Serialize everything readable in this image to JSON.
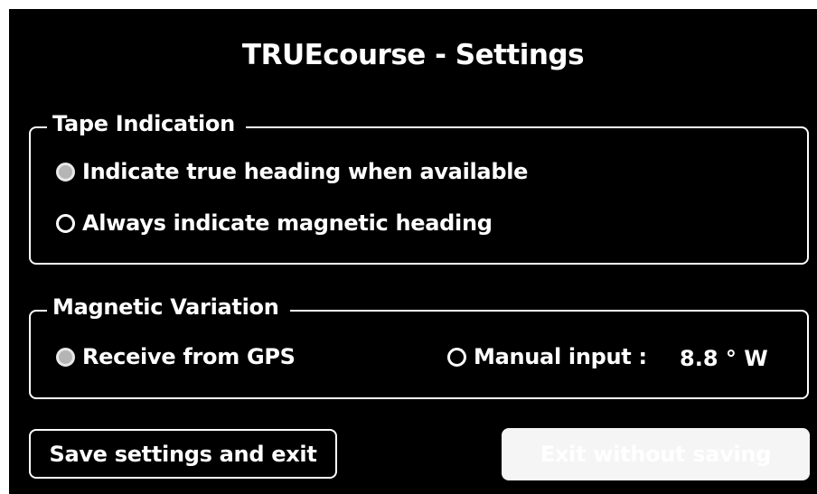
{
  "title": "TRUEcourse - Settings",
  "tape": {
    "legend": "Tape Indication",
    "options": [
      {
        "label": "Indicate true heading when available",
        "selected": true
      },
      {
        "label": "Always indicate magnetic heading",
        "selected": false
      }
    ]
  },
  "variation": {
    "legend": "Magnetic Variation",
    "options": [
      {
        "label": "Receive from GPS",
        "selected": true
      },
      {
        "label": "Manual input :",
        "selected": false
      }
    ],
    "manual_value": "8.8 ° W"
  },
  "buttons": {
    "save": "Save settings and exit",
    "exit": "Exit without saving"
  },
  "colors": {
    "background": "#000000",
    "foreground": "#ffffff",
    "selected_radio": "#b5b5b5"
  }
}
